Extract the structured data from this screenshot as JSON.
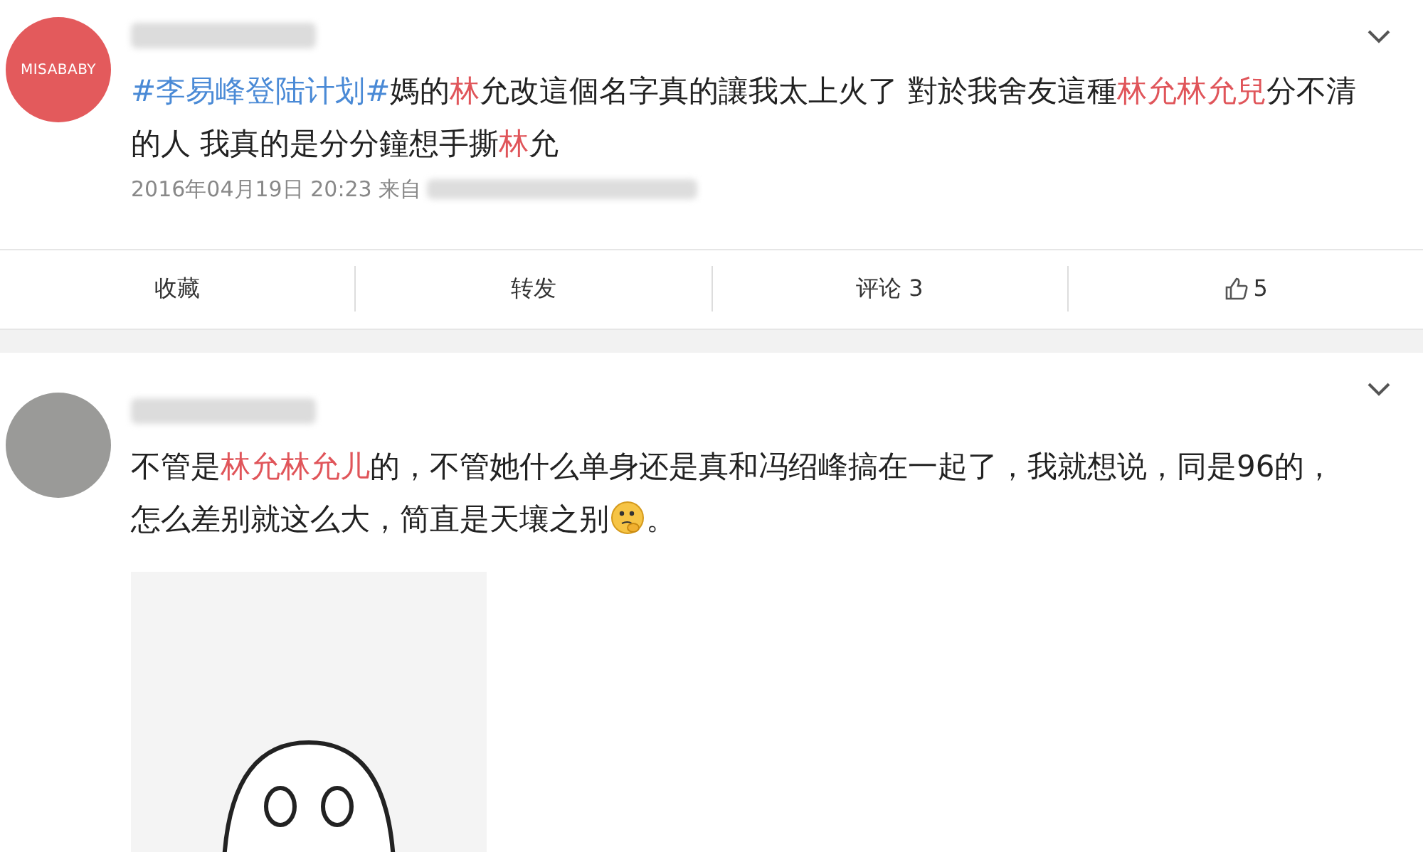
{
  "posts": [
    {
      "avatar": {
        "kind": "logo",
        "text": "MISABABY"
      },
      "text": [
        {
          "kind": "topic",
          "text": "#李易峰登陆计划#"
        },
        {
          "kind": "plain",
          "text": "媽的"
        },
        {
          "kind": "highlight",
          "text": "林"
        },
        {
          "kind": "plain",
          "text": "允改這個名字真的讓我太上火了 對於我舍友這種"
        },
        {
          "kind": "highlight",
          "text": "林允林允兒"
        },
        {
          "kind": "plain",
          "text": "分不清的人 我真的是分分鐘想手撕"
        },
        {
          "kind": "highlight",
          "text": "林"
        },
        {
          "kind": "plain",
          "text": "允"
        }
      ],
      "meta": "2016年04月19日 20:23 来自",
      "actions": [
        {
          "kind": "text",
          "label": "收藏"
        },
        {
          "kind": "text",
          "label": "转发"
        },
        {
          "kind": "text",
          "label": "评论 3"
        },
        {
          "kind": "like",
          "label": "5"
        }
      ]
    },
    {
      "avatar": {
        "kind": "photo"
      },
      "text": [
        {
          "kind": "plain",
          "text": "不管是"
        },
        {
          "kind": "highlight",
          "text": "林允林允儿"
        },
        {
          "kind": "plain",
          "text": "的，不管她什么单身还是真和冯绍峰搞在一起了，我就想说，同是96的，怎么差别就这么大，简直是天壤之别"
        },
        {
          "kind": "emoji"
        },
        {
          "kind": "plain",
          "text": "。"
        }
      ],
      "image": true
    }
  ]
}
